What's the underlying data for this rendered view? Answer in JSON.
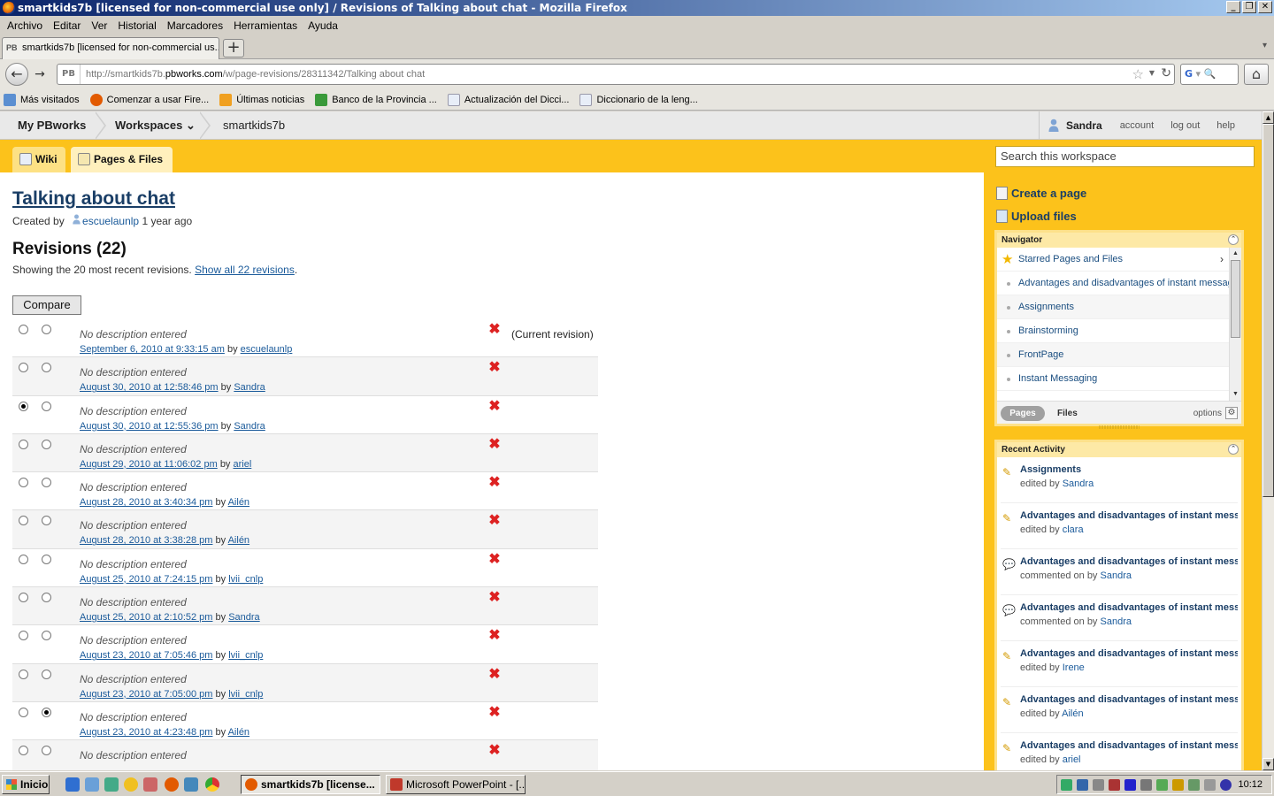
{
  "window": {
    "title": "smartkids7b [licensed for non-commercial use only] / Revisions of Talking about chat - Mozilla Firefox"
  },
  "menubar": [
    "Archivo",
    "Editar",
    "Ver",
    "Historial",
    "Marcadores",
    "Herramientas",
    "Ayuda"
  ],
  "tab": {
    "title": "smartkids7b [licensed for non-commercial us...",
    "favicon": "PB"
  },
  "navbar": {
    "url_prefix": "http://smartkids7b.",
    "url_domain": "pbworks.com",
    "url_suffix": "/w/page-revisions/28311342/Talking about chat",
    "site_badge": "PB",
    "search_engine": "G"
  },
  "bookmarks": [
    {
      "label": "Más visitados",
      "icon": "folder-icon",
      "color": "#5b8fd1"
    },
    {
      "label": "Comenzar a usar Fire...",
      "icon": "firefox-icon",
      "color": "#e25a00"
    },
    {
      "label": "Últimas noticias",
      "icon": "rss-icon",
      "color": "#f0a020"
    },
    {
      "label": "Banco de la Provincia ...",
      "icon": "bank-icon",
      "color": "#3a9a3a"
    },
    {
      "label": "Actualización del Dicci...",
      "icon": "page-icon",
      "color": "#e8eef8"
    },
    {
      "label": "Diccionario de la leng...",
      "icon": "page-icon",
      "color": "#e8eef8"
    }
  ],
  "pbheader": {
    "my_pbworks": "My PBworks",
    "workspaces": "Workspaces",
    "workspace_name": "smartkids7b",
    "user": "Sandra",
    "account": "account",
    "logout": "log out",
    "help": "help"
  },
  "toolbar": {
    "wiki": "Wiki",
    "pages_files": "Pages & Files",
    "search_placeholder": "Search this workspace"
  },
  "page": {
    "title": "Talking about chat",
    "created_by_label": "Created by",
    "creator": "escuelaunlp",
    "created_ago": "1 year ago",
    "revisions_heading": "Revisions (22)",
    "showing_text": "Showing the 20 most recent revisions.",
    "show_all_link": "Show all 22 revisions",
    "compare_button": "Compare",
    "by_label": "by",
    "current_revision": "(Current revision)"
  },
  "revisions": [
    {
      "desc": "No description entered",
      "date": "September 6, 2010 at 9:33:15 am",
      "user": "escuelaunlp",
      "r1": false,
      "r2": false,
      "current": true
    },
    {
      "desc": "No description entered",
      "date": "August 30, 2010 at 12:58:46 pm",
      "user": "Sandra",
      "r1": false,
      "r2": false,
      "current": false
    },
    {
      "desc": "No description entered",
      "date": "August 30, 2010 at 12:55:36 pm",
      "user": "Sandra",
      "r1": true,
      "r2": false,
      "current": false
    },
    {
      "desc": "No description entered",
      "date": "August 29, 2010 at 11:06:02 pm",
      "user": "ariel",
      "r1": false,
      "r2": false,
      "current": false
    },
    {
      "desc": "No description entered",
      "date": "August 28, 2010 at 3:40:34 pm",
      "user": "Ailén",
      "r1": false,
      "r2": false,
      "current": false
    },
    {
      "desc": "No description entered",
      "date": "August 28, 2010 at 3:38:28 pm",
      "user": "Ailén",
      "r1": false,
      "r2": false,
      "current": false
    },
    {
      "desc": "No description entered",
      "date": "August 25, 2010 at 7:24:15 pm",
      "user": "lvii_cnlp",
      "r1": false,
      "r2": false,
      "current": false
    },
    {
      "desc": "No description entered",
      "date": "August 25, 2010 at 2:10:52 pm",
      "user": "Sandra",
      "r1": false,
      "r2": false,
      "current": false
    },
    {
      "desc": "No description entered",
      "date": "August 23, 2010 at 7:05:46 pm",
      "user": "lvii_cnlp",
      "r1": false,
      "r2": false,
      "current": false
    },
    {
      "desc": "No description entered",
      "date": "August 23, 2010 at 7:05:00 pm",
      "user": "lvii_cnlp",
      "r1": false,
      "r2": false,
      "current": false
    },
    {
      "desc": "No description entered",
      "date": "August 23, 2010 at 4:23:48 pm",
      "user": "Ailén",
      "r1": false,
      "r2": true,
      "current": false
    },
    {
      "desc": "No description entered",
      "date": "",
      "user": "",
      "r1": false,
      "r2": false,
      "current": false
    }
  ],
  "sidebar": {
    "create_page": "Create a page",
    "upload_files": "Upload files",
    "navigator": {
      "title": "Navigator",
      "starred": "Starred Pages and Files",
      "items": [
        "Advantages and disadvantages of instant messaging",
        "Assignments",
        "Brainstorming",
        "FrontPage",
        "Instant Messaging"
      ],
      "pages_tab": "Pages",
      "files_tab": "Files",
      "options": "options"
    },
    "recent_activity": {
      "title": "Recent Activity",
      "items": [
        {
          "title": "Assignments",
          "action": "edited by",
          "user": "Sandra",
          "icon": "pencil-icon"
        },
        {
          "title": "Advantages and disadvantages of instant messaging",
          "action": "edited by",
          "user": "clara",
          "icon": "pencil-icon"
        },
        {
          "title": "Advantages and disadvantages of instant messaging",
          "action": "commented on by",
          "user": "Sandra",
          "icon": "comment-icon"
        },
        {
          "title": "Advantages and disadvantages of instant messaging",
          "action": "commented on by",
          "user": "Sandra",
          "icon": "comment-icon"
        },
        {
          "title": "Advantages and disadvantages of instant messaging",
          "action": "edited by",
          "user": "Irene",
          "icon": "pencil-icon"
        },
        {
          "title": "Advantages and disadvantages of instant messaging",
          "action": "edited by",
          "user": "Ailén",
          "icon": "pencil-icon"
        },
        {
          "title": "Advantages and disadvantages of instant messaging",
          "action": "edited by",
          "user": "ariel",
          "icon": "pencil-icon"
        }
      ]
    }
  },
  "taskbar": {
    "start": "Inicio",
    "tasks": [
      {
        "label": "smartkids7b [license...",
        "active": true,
        "color": "#e25a00"
      },
      {
        "label": "Microsoft PowerPoint - [...",
        "active": false,
        "color": "#c0392b"
      }
    ],
    "clock": "10:12"
  }
}
